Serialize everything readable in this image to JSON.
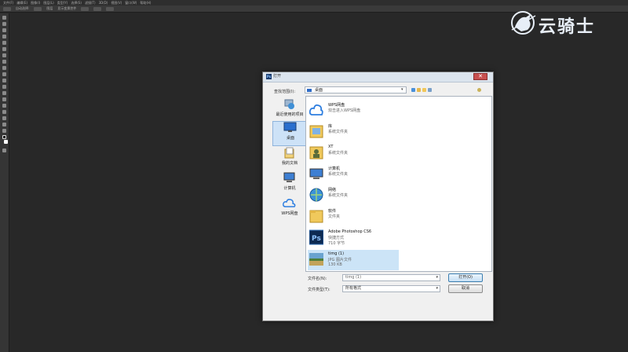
{
  "menubar": {
    "items": [
      "文件(F)",
      "编辑(E)",
      "图像(I)",
      "图层(L)",
      "类型(Y)",
      "选择(S)",
      "滤镜(T)",
      "3D(D)",
      "视图(V)",
      "窗口(W)",
      "帮助(H)"
    ]
  },
  "optionsbar": {
    "items": [
      "自动选择:",
      "图层",
      "显示变换控件"
    ]
  },
  "watermark": {
    "text": "云骑士",
    "color": "#e7eef7"
  },
  "dialog": {
    "title": "打开",
    "badge": "Ps",
    "close_glyph": "✕",
    "lookin_label": "查找范围(I):",
    "lookin_value": "桌面",
    "places": [
      {
        "label": "最近使用的项目",
        "icon": "recent-items-icon"
      },
      {
        "label": "桌面",
        "icon": "desktop-icon",
        "selected": true
      },
      {
        "label": "我的文档",
        "icon": "documents-icon"
      },
      {
        "label": "计算机",
        "icon": "computer-icon"
      },
      {
        "label": "WPS网盘",
        "icon": "wps-cloud-icon"
      }
    ],
    "files": [
      {
        "name": "WPS网盘",
        "sub": "双击进入WPS网盘",
        "icon": "wps-cloud-icon"
      },
      {
        "name": "库",
        "sub": "系统文件夹",
        "icon": "library-folder-icon"
      },
      {
        "name": "XT",
        "sub": "系统文件夹",
        "icon": "user-folder-icon"
      },
      {
        "name": "计算机",
        "sub": "系统文件夹",
        "icon": "computer-icon"
      },
      {
        "name": "网络",
        "sub": "系统文件夹",
        "icon": "network-icon"
      },
      {
        "name": "软件",
        "sub": "文件夹",
        "icon": "folder-icon"
      },
      {
        "name": "Adobe Photoshop CS6",
        "sub": "快捷方式",
        "sub2": "710 字节",
        "icon": "photoshop-icon"
      },
      {
        "name": "timg (1)",
        "sub": "JPG 图片文件",
        "sub2": "130 KB",
        "icon": "image-thumbnail-icon",
        "selected": true
      }
    ],
    "filename_label": "文件名(N):",
    "filename_value": "timg (1)",
    "filetype_label": "文件类型(T):",
    "filetype_value": "所有格式",
    "open_button": "打开(O)",
    "cancel_button": "取消"
  }
}
